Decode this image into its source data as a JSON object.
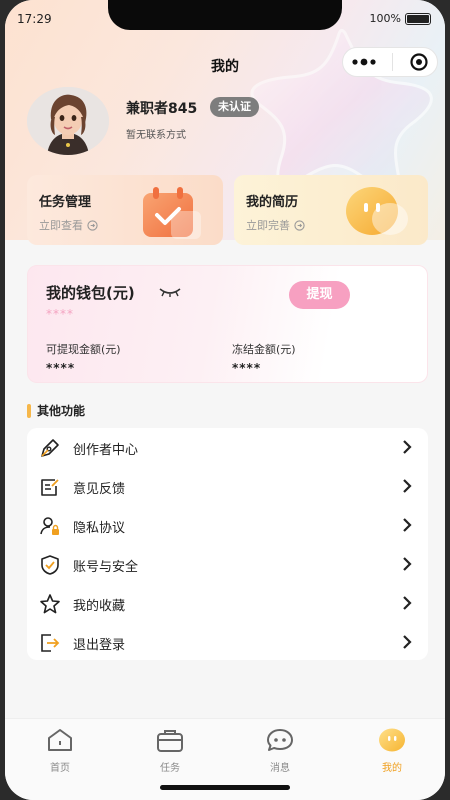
{
  "status": {
    "time": "17:29",
    "battery": "100%"
  },
  "header": {
    "title": "我的"
  },
  "profile": {
    "username": "兼职者845",
    "badge": "未认证",
    "contact": "暂无联系方式"
  },
  "cards": {
    "task": {
      "title": "任务管理",
      "sub": "立即查看"
    },
    "resume": {
      "title": "我的简历",
      "sub": "立即完善"
    }
  },
  "wallet": {
    "title": "我的钱包(元)",
    "hidden_total": "****",
    "withdraw_label": "提现",
    "withdrawable_label": "可提现金额(元)",
    "withdrawable_value": "****",
    "frozen_label": "冻结金额(元)",
    "frozen_value": "****"
  },
  "other": {
    "title": "其他功能",
    "items": [
      {
        "label": "创作者中心",
        "icon": "pen-icon"
      },
      {
        "label": "意见反馈",
        "icon": "feedback-icon"
      },
      {
        "label": "隐私协议",
        "icon": "privacy-icon"
      },
      {
        "label": "账号与安全",
        "icon": "shield-icon"
      },
      {
        "label": "我的收藏",
        "icon": "star-icon"
      },
      {
        "label": "退出登录",
        "icon": "logout-icon"
      }
    ]
  },
  "tabs": [
    {
      "label": "首页",
      "icon": "home-icon"
    },
    {
      "label": "任务",
      "icon": "briefcase-icon"
    },
    {
      "label": "消息",
      "icon": "message-icon"
    },
    {
      "label": "我的",
      "icon": "profile-icon",
      "active": true
    }
  ],
  "colors": {
    "accent": "#f0a020",
    "pink": "#f7a0c1",
    "badge": "#7d7d7d"
  }
}
